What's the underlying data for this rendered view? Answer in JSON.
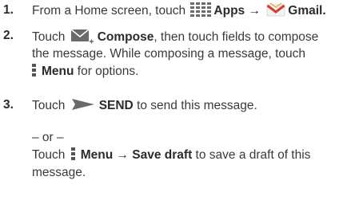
{
  "steps": [
    {
      "number": "1.",
      "lines": [
        {
          "pre": "From a Home screen, touch",
          "apps_label": "Apps",
          "arrow": "→",
          "gmail_label": "Gmail."
        }
      ]
    },
    {
      "number": "2.",
      "line1_pre": "Touch",
      "compose_label": "Compose",
      "line1_post": ", then touch fields to compose",
      "line2": "the message. While composing a message, touch",
      "menu_label": "Menu",
      "line3_post": " for options."
    },
    {
      "number": "3.",
      "line1_pre": "Touch",
      "send_label": "SEND",
      "line1_post": " to send this message.",
      "or": "– or –",
      "line3_pre": "Touch",
      "menu_label": "Menu",
      "arrow": "→",
      "save_draft_label": "Save draft",
      "line3_post": " to save a draft of this",
      "line4": "message."
    }
  ],
  "icons": {
    "apps": "apps-grid-icon",
    "gmail": "gmail-icon",
    "compose": "compose-icon",
    "menu": "menu-icon",
    "send": "send-icon"
  },
  "colors": {
    "text": "#3a3a3a",
    "bold": "#2b2b2b",
    "gmail_red": "#d93b2b"
  }
}
